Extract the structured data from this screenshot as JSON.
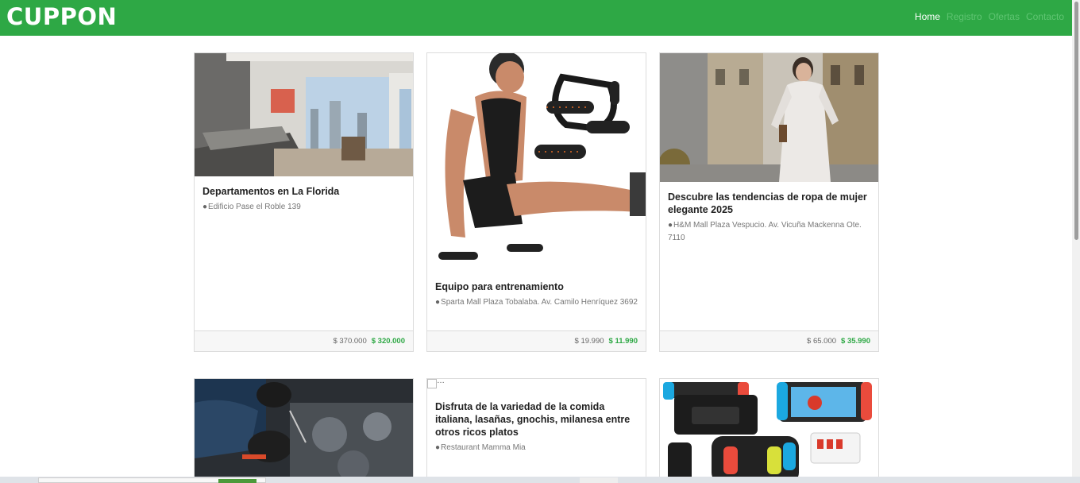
{
  "header": {
    "brand": "CUPPON",
    "nav": [
      {
        "label": "Home",
        "active": true
      },
      {
        "label": "Registro",
        "active": false
      },
      {
        "label": "Ofertas",
        "active": false
      },
      {
        "label": "Contacto",
        "active": false
      }
    ]
  },
  "colors": {
    "accent": "#2ea845",
    "price_new": "#2ea845"
  },
  "cards": [
    {
      "title": "Departamentos en La Florida",
      "icon": "map-marker-icon",
      "address": "Edificio Pase el Roble 139",
      "old_price": "$ 370.000",
      "new_price": "$ 320.000"
    },
    {
      "title": "Equipo para entrenamiento",
      "icon": "map-marker-icon",
      "address": "Sparta Mall Plaza Tobalaba. Av. Camilo Henríquez 3692",
      "old_price": "$ 19.990",
      "new_price": "$ 11.990"
    },
    {
      "title": "Descubre las tendencias de ropa de mujer elegante 2025",
      "icon": "map-marker-icon",
      "address": "H&M Mall Plaza Vespucio. Av. Vicuña Mackenna Ote. 7110",
      "old_price": "$ 65.000",
      "new_price": "$ 35.990"
    },
    {
      "title": "",
      "address": "",
      "old_price": "",
      "new_price": ""
    },
    {
      "title": "Disfruta de la variedad de la comida italiana, lasañas, gnochis, milanesa entre otros ricos platos",
      "icon": "map-marker-icon",
      "address": "Restaurant Mamma Mia",
      "old_price": "",
      "new_price": ""
    },
    {
      "title": "",
      "address": "",
      "old_price": "",
      "new_price": ""
    }
  ]
}
